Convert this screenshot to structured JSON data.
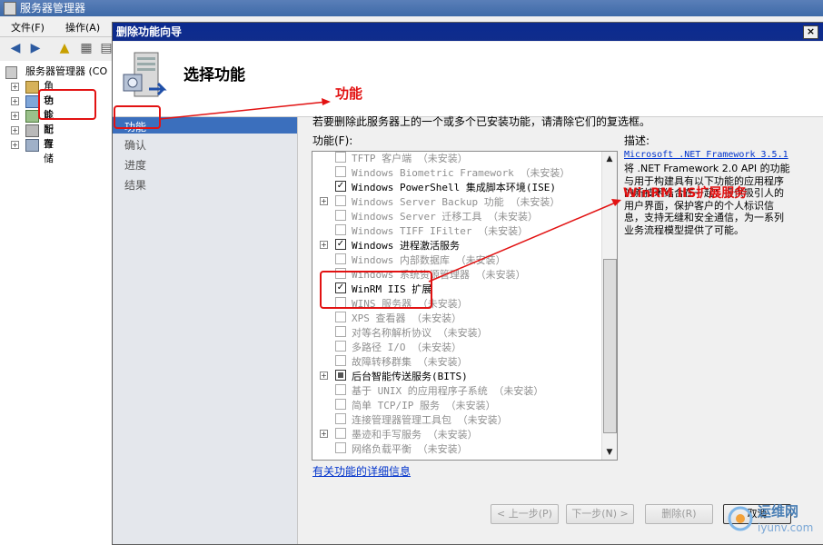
{
  "window": {
    "title": "服务器管理器"
  },
  "menubar": {
    "items": [
      "文件(F)",
      "操作(A)"
    ]
  },
  "tree": {
    "root": "服务器管理器 (CO",
    "items": [
      "角色",
      "功能",
      "诊断",
      "配置",
      "存储"
    ]
  },
  "dialog": {
    "title": "删除功能向导",
    "close": "×",
    "header_title": "选择功能",
    "nav": [
      "功能",
      "确认",
      "进度",
      "结果"
    ],
    "instruction": "若要删除此服务器上的一个或多个已安装功能，请清除它们的复选框。",
    "list_label": "功能(F):",
    "desc_label": "描述:",
    "features": [
      {
        "text": "TFTP 客户端  （未安装）",
        "checked": false,
        "enabled": false,
        "expander": false
      },
      {
        "text": "Windows Biometric Framework  （未安装）",
        "checked": false,
        "enabled": false,
        "expander": false
      },
      {
        "text": "Windows PowerShell 集成脚本环境(ISE)",
        "checked": true,
        "enabled": true,
        "expander": false
      },
      {
        "text": "Windows Server Backup 功能  （未安装）",
        "checked": false,
        "enabled": false,
        "expander": true
      },
      {
        "text": "Windows Server 迁移工具  （未安装）",
        "checked": false,
        "enabled": false,
        "expander": false
      },
      {
        "text": "Windows TIFF IFilter  （未安装）",
        "checked": false,
        "enabled": false,
        "expander": false
      },
      {
        "text": "Windows 进程激活服务",
        "checked": true,
        "enabled": true,
        "expander": true
      },
      {
        "text": "Windows 内部数据库  （未安装）",
        "checked": false,
        "enabled": false,
        "expander": false
      },
      {
        "text": "Windows 系统资源管理器  （未安装）",
        "checked": false,
        "enabled": false,
        "expander": false
      },
      {
        "text": "WinRM IIS 扩展",
        "checked": true,
        "enabled": true,
        "expander": false
      },
      {
        "text": "WINS 服务器  （未安装）",
        "checked": false,
        "enabled": false,
        "expander": false
      },
      {
        "text": "XPS 查看器  （未安装）",
        "checked": false,
        "enabled": false,
        "expander": false
      },
      {
        "text": "对等名称解析协议  （未安装）",
        "checked": false,
        "enabled": false,
        "expander": false
      },
      {
        "text": "多路径 I/O  （未安装）",
        "checked": false,
        "enabled": false,
        "expander": false
      },
      {
        "text": "故障转移群集  （未安装）",
        "checked": false,
        "enabled": false,
        "expander": false
      },
      {
        "text": "后台智能传送服务(BITS)",
        "checked": "mixed",
        "enabled": true,
        "expander": true
      },
      {
        "text": "基于 UNIX 的应用程序子系统  （未安装）",
        "checked": false,
        "enabled": false,
        "expander": false
      },
      {
        "text": "简单 TCP/IP 服务  （未安装）",
        "checked": false,
        "enabled": false,
        "expander": false
      },
      {
        "text": "连接管理器管理工具包  （未安装）",
        "checked": false,
        "enabled": false,
        "expander": false
      },
      {
        "text": "墨迹和手写服务  （未安装）",
        "checked": false,
        "enabled": false,
        "expander": true
      },
      {
        "text": "网络负载平衡  （未安装）",
        "checked": false,
        "enabled": false,
        "expander": false
      }
    ],
    "description": {
      "link": "Microsoft .NET Framework 3.5.1",
      "text": "将 .NET Framework 2.0 API 的功能与用于构建具有以下功能的应用程序的新技术结合在一起：提供吸引人的用户界面，保护客户的个人标识信息，支持无缝和安全通信，为一系列业务流程模型提供了可能。"
    },
    "detail_link": "有关功能的详细信息",
    "buttons": {
      "prev": "< 上一步(P)",
      "next": "下一步(N) >",
      "remove": "删除(R)",
      "cancel": "取消"
    }
  },
  "annotations": {
    "label_feature": "功能",
    "label_winrm": "WinRM IIS扩展服务"
  },
  "watermark": {
    "top": "运维网",
    "bottom": "iyunv.com"
  },
  "colors": {
    "annotation": "#e21212",
    "selection": "#3b6fbd",
    "dialog_title": "#0b2a8f"
  }
}
